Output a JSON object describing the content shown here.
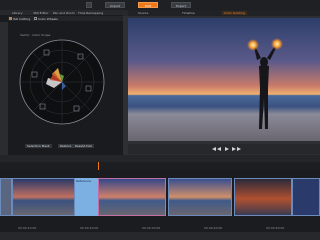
{
  "app": {
    "mode_tabs": [
      {
        "label": "Import",
        "active": false
      },
      {
        "label": "Edit",
        "active": true
      },
      {
        "label": "Export",
        "active": false
      }
    ],
    "accent_color": "#f07a1a"
  },
  "left_panel": {
    "tabs": [
      "Library",
      "360 Editor",
      "Pan and Zoom",
      "Time Remapping"
    ],
    "filters": [
      {
        "label": "ISO Cutting",
        "checked": true
      },
      {
        "label": "Color Wheels",
        "checked": false
      }
    ],
    "scope_header": "Vector · Color Scope",
    "bottom_buttons": [
      "Selection Mask",
      "Restore",
      "Reset/Undo"
    ]
  },
  "preview": {
    "tabs": [
      {
        "label": "Source",
        "active": false
      },
      {
        "label": "Timeline",
        "active": false
      },
      {
        "label": "Color Grading",
        "active": true
      }
    ]
  },
  "timeline": {
    "timecodes": [
      "00:00:10:00",
      "00:00:20:00",
      "00:00:30:00",
      "00:00:40:00",
      "00:00:50:00"
    ],
    "clip_tag": "Reference"
  },
  "icons": {
    "home": "home-icon",
    "play": "play-icon",
    "rewind": "rewind-icon",
    "forward": "forward-icon",
    "loop": "loop-icon"
  }
}
